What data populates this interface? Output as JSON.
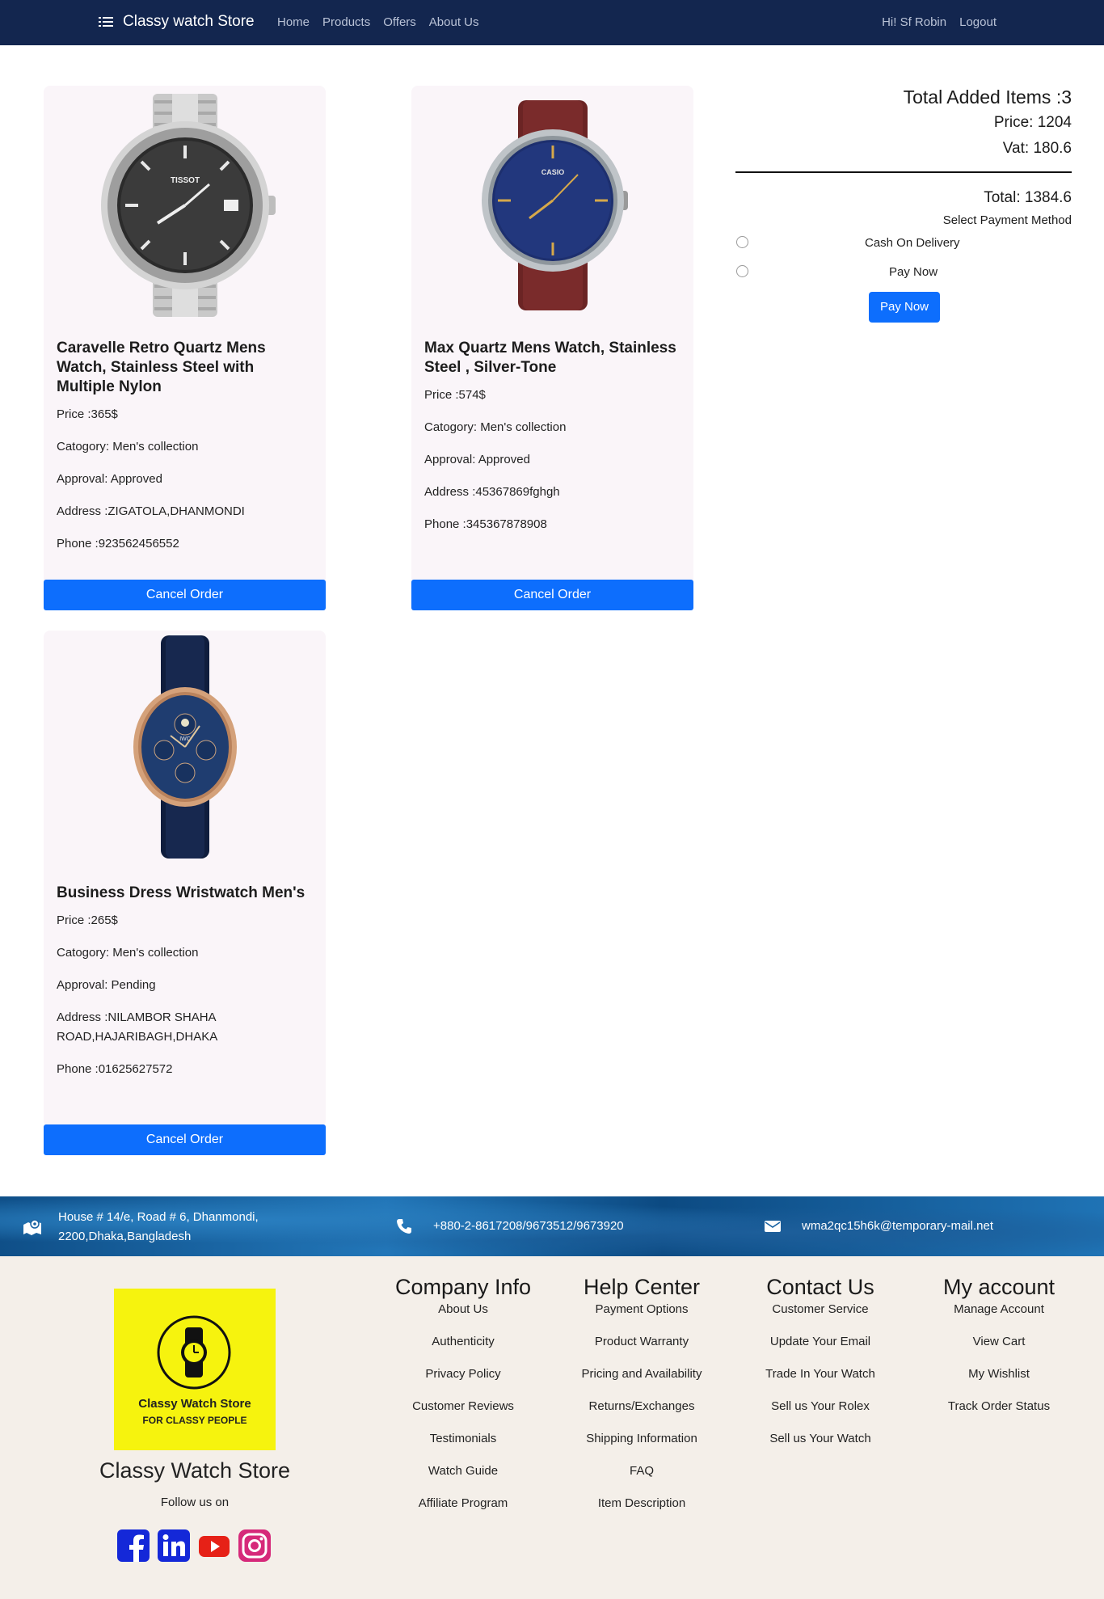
{
  "navbar": {
    "brand": "Classy watch Store",
    "links": [
      "Home",
      "Products",
      "Offers",
      "About Us"
    ],
    "greeting": "Hi! Sf Robin",
    "logout": "Logout"
  },
  "orders": [
    {
      "title": "Caravelle Retro Quartz Mens Watch, Stainless Steel with Multiple Nylon",
      "price": "Price :365$",
      "category": "Catogory: Men's collection",
      "approval": "Approval: Approved",
      "address": "Address :ZIGATOLA,DHANMONDI",
      "phone": "Phone :923562456552",
      "image": "tissot-steel-watch",
      "button": "Cancel Order"
    },
    {
      "title": "Max Quartz Mens Watch, Stainless Steel , Silver-Tone",
      "price": "Price :574$",
      "category": "Catogory: Men's collection",
      "approval": "Approval: Approved",
      "address": "Address :45367869fghgh",
      "phone": "Phone :345367878908",
      "image": "casio-leather-watch",
      "button": "Cancel Order"
    },
    {
      "title": "Business Dress Wristwatch Men's",
      "price": "Price :265$",
      "category": "Catogory: Men's collection",
      "approval": "Approval: Pending",
      "address": "Address :NILAMBOR SHAHA ROAD,HAJARIBAGH,DHAKA",
      "phone": "Phone :01625627572",
      "image": "iwc-blue-dress-watch",
      "button": "Cancel Order"
    }
  ],
  "summary": {
    "items": "Total Added Items :3",
    "price": "Price: 1204",
    "vat": "Vat: 180.6",
    "total": "Total: 1384.6",
    "method_label": "Select Payment Method",
    "option_cod": "Cash On Delivery",
    "option_pay": "Pay Now",
    "pay_button": "Pay Now"
  },
  "contact_band": {
    "address_line1": "House # 14/e, Road # 6, Dhanmondi,",
    "address_line2": "2200,Dhaka,Bangladesh",
    "phone": "+880-2-8617208/9673512/9673920",
    "email": "wma2qc15h6k@temporary-mail.net"
  },
  "footer": {
    "logo_title": "Classy Watch Store",
    "logo_sub": "FOR CLASSY PEOPLE",
    "store_name": "Classy Watch Store",
    "follow": "Follow us on",
    "columns": [
      {
        "title": "Company Info",
        "items": [
          "About Us",
          "Authenticity",
          "Privacy Policy",
          "Customer Reviews",
          "Testimonials",
          "Watch Guide",
          "Affiliate Program"
        ]
      },
      {
        "title": "Help Center",
        "items": [
          "Payment Options",
          "Product Warranty",
          "Pricing and Availability",
          "Returns/Exchanges",
          "Shipping Information",
          "FAQ",
          "Item Description"
        ]
      },
      {
        "title": "Contact Us",
        "items": [
          "Customer Service",
          "Update Your Email",
          "Trade In Your Watch",
          "Sell us Your Rolex",
          "Sell us Your Watch"
        ]
      },
      {
        "title": "My account",
        "items": [
          "Manage Account",
          "View Cart",
          "My Wishlist",
          "Track Order Status"
        ]
      }
    ]
  },
  "colors": {
    "navbar": "#13264f",
    "primary": "#0d6efd",
    "card_bg": "#faf5f9",
    "footer_bg": "#f4efe9",
    "logo_bg": "#f6f30e"
  }
}
